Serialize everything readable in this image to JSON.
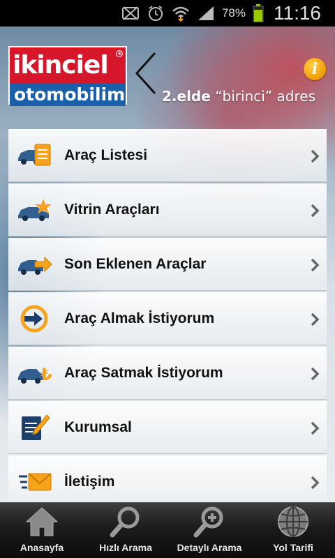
{
  "status_bar": {
    "battery_percent": "78%",
    "time": "11:16",
    "icons": [
      "mute-icon",
      "alarm-icon",
      "wifi-icon",
      "signal-icon",
      "battery-icon"
    ]
  },
  "header": {
    "logo_top": "ikinciel",
    "logo_reg": "®",
    "logo_bottom": "otomobilim",
    "tagline_bold": "2.elde",
    "tagline_rest": " “birinci” adres",
    "info_label": "i"
  },
  "menu": {
    "items": [
      {
        "label": "Araç Listesi",
        "icon": "car-list-icon"
      },
      {
        "label": "Vitrin Araçları",
        "icon": "car-star-icon"
      },
      {
        "label": "Son Eklenen Araçlar",
        "icon": "car-new-icon"
      },
      {
        "label": "Araç Almak İstiyorum",
        "icon": "buy-car-icon"
      },
      {
        "label": "Araç Satmak İstiyorum",
        "icon": "sell-car-icon"
      },
      {
        "label": "Kurumsal",
        "icon": "corporate-icon"
      },
      {
        "label": "İletişim",
        "icon": "mail-icon"
      }
    ]
  },
  "tabbar": {
    "tabs": [
      {
        "label": "Anasayfa",
        "icon": "home-icon"
      },
      {
        "label": "Hızlı Arama",
        "icon": "search-icon"
      },
      {
        "label": "Detaylı Arama",
        "icon": "zoom-in-icon"
      },
      {
        "label": "Yol Tarifi",
        "icon": "globe-icon"
      }
    ]
  },
  "colors": {
    "brand_red": "#d6162a",
    "brand_blue": "#1a5fa8",
    "accent_orange": "#f19a00"
  }
}
